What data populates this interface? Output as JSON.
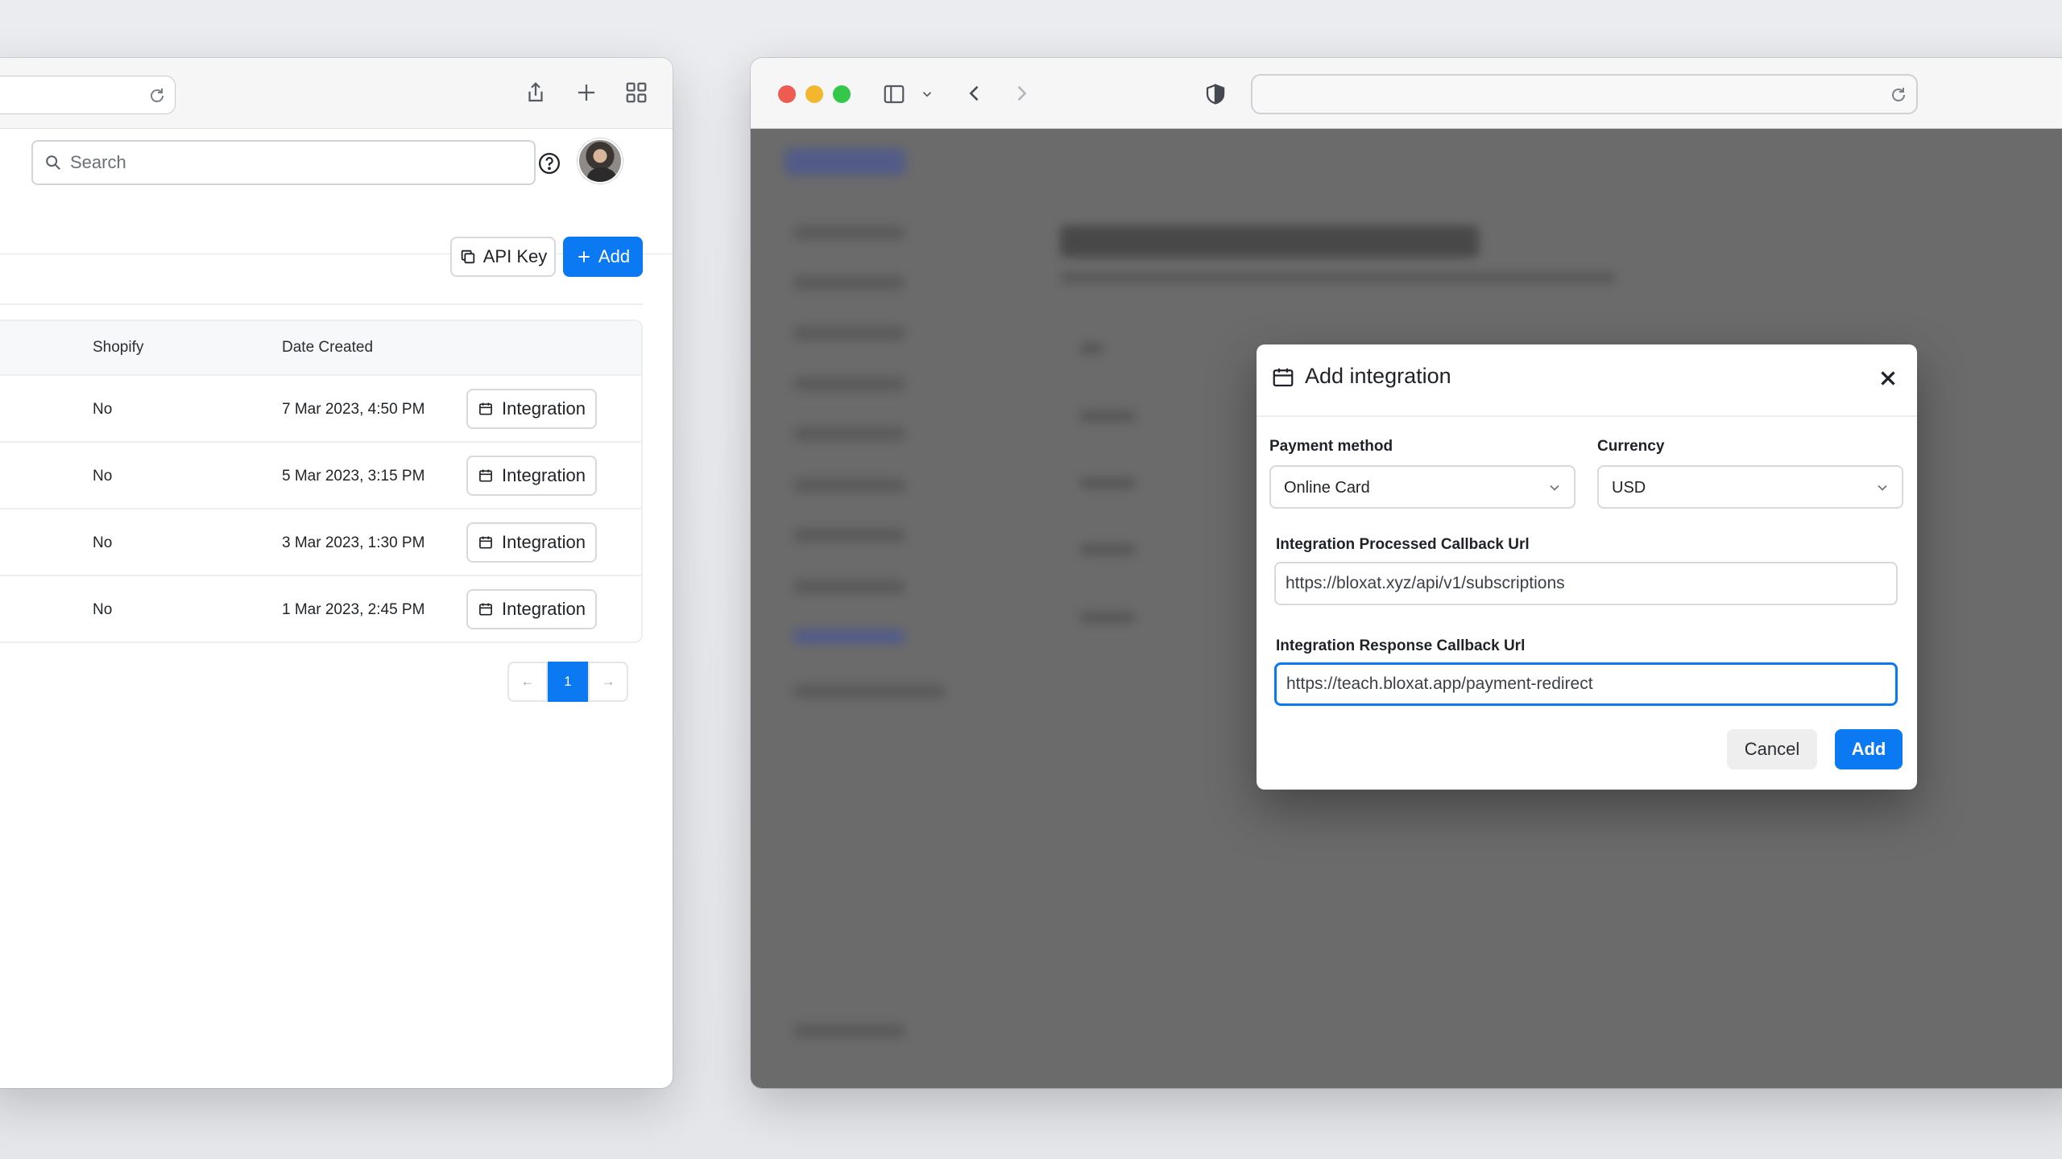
{
  "left_window": {
    "search": {
      "placeholder": "Search"
    },
    "buttons": {
      "api_key": "API Key",
      "add": "Add"
    },
    "table": {
      "columns": [
        "Shopify",
        "Date Created"
      ],
      "rows": [
        {
          "shopify": "No",
          "date": "7 Mar 2023, 4:50 PM",
          "action": "Integration"
        },
        {
          "shopify": "No",
          "date": "5 Mar 2023, 3:15 PM",
          "action": "Integration"
        },
        {
          "shopify": "No",
          "date": "3 Mar 2023, 1:30 PM",
          "action": "Integration"
        },
        {
          "shopify": "No",
          "date": "1 Mar 2023, 2:45 PM",
          "action": "Integration"
        }
      ]
    },
    "pagination": {
      "prev": "←",
      "current": "1",
      "next": "→"
    }
  },
  "modal": {
    "title": "Add integration",
    "payment_method": {
      "label": "Payment method",
      "value": "Online Card"
    },
    "currency": {
      "label": "Currency",
      "value": "USD"
    },
    "processed_callback": {
      "label": "Integration Processed Callback Url",
      "value": "https://bloxat.xyz/api/v1/subscriptions"
    },
    "response_callback": {
      "label": "Integration Response Callback Url",
      "value": "https://teach.bloxat.app/payment-redirect"
    },
    "buttons": {
      "cancel": "Cancel",
      "submit": "Add"
    }
  },
  "colors": {
    "primary": "#0a79f2",
    "traffic_red": "#ee5b51",
    "traffic_yellow": "#f2b62f",
    "traffic_green": "#34c749",
    "overlay": "#6b6b6b"
  }
}
